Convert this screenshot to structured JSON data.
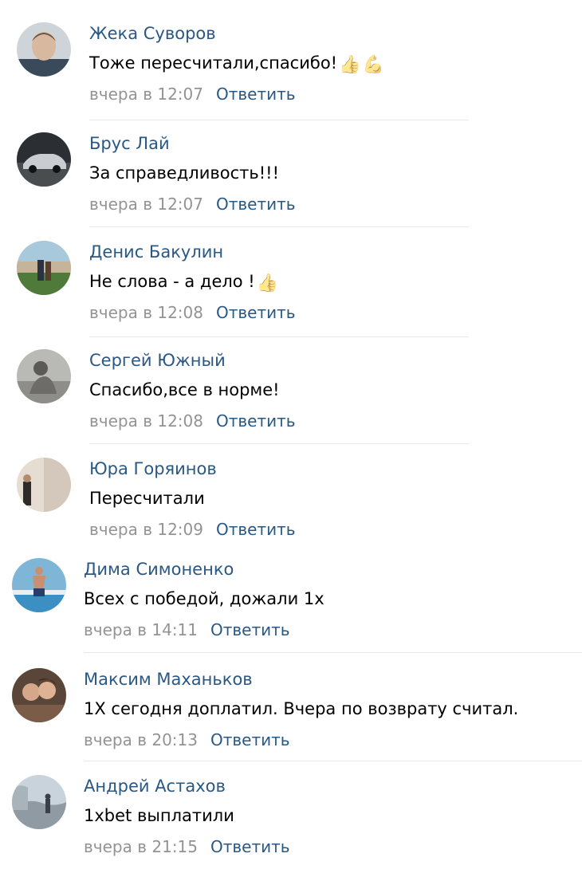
{
  "reply_label": "Ответить",
  "colors": {
    "author": "#2a5885",
    "text": "#000000",
    "time": "#939393",
    "divider": "#e7e8ec"
  },
  "comments": [
    {
      "author": "Жека Суворов",
      "text": "Тоже пересчитали,спасибо!",
      "emoji": [
        "👍",
        "💪"
      ],
      "time": "вчера в 12:07",
      "avatar": "avatar-photo-man-portrait"
    },
    {
      "author": "Брус Лай",
      "text": "За справедливость!!!",
      "emoji": [],
      "time": "вчера в 12:07",
      "avatar": "avatar-photo-car"
    },
    {
      "author": "Денис Бакулин",
      "text": "Не слова - а дело !",
      "emoji": [
        "👍"
      ],
      "time": "вчера в 12:08",
      "avatar": "avatar-photo-outdoor"
    },
    {
      "author": "Сергей Южный",
      "text": "Спасибо,все в норме!",
      "emoji": [],
      "time": "вчера в 12:08",
      "avatar": "avatar-photo-bw"
    },
    {
      "author": "Юра Горяинов",
      "text": "Пересчитали",
      "emoji": [],
      "time": "вчера в 12:09",
      "avatar": "avatar-photo-indoor"
    },
    {
      "author": "Дима Симоненко",
      "text": "Всех с победой, дожали 1х",
      "emoji": [],
      "time": "вчера в 14:11",
      "avatar": "avatar-photo-sea"
    },
    {
      "author": "Максим Маханьков",
      "text": "1Х сегодня доплатил. Вчера по возврату считал.",
      "emoji": [],
      "time": "вчера в 20:13",
      "avatar": "avatar-photo-couple"
    },
    {
      "author": "Андрей Астахов",
      "text": "1xbet выплатили",
      "emoji": [],
      "time": "вчера в 21:15",
      "avatar": "avatar-photo-landscape"
    }
  ]
}
